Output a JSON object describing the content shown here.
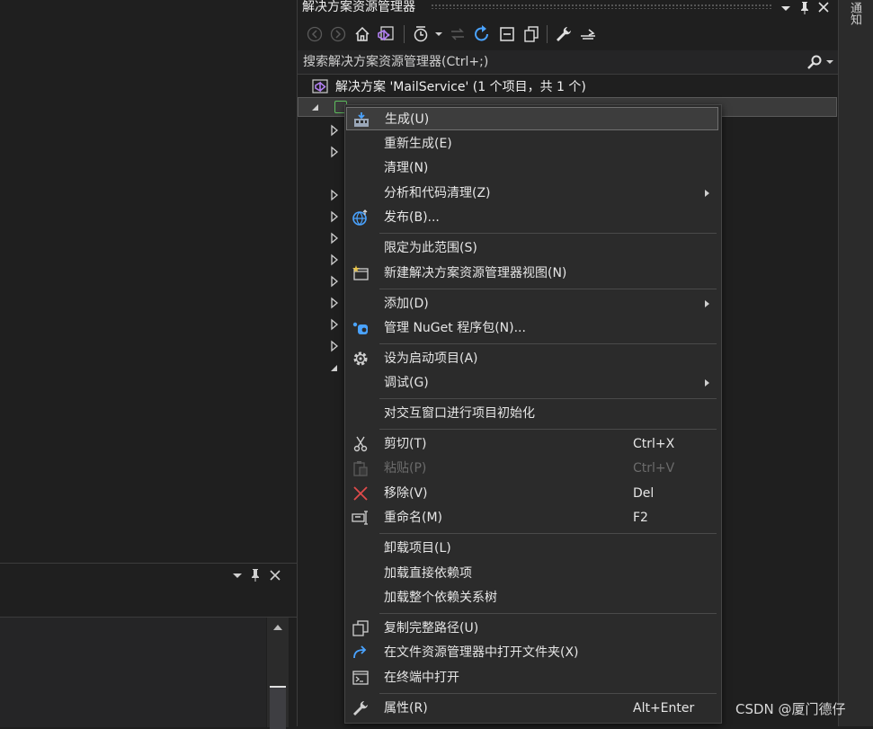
{
  "solution_explorer": {
    "title": "解决方案资源管理器",
    "search_placeholder": "搜索解决方案资源管理器(Ctrl+;)",
    "solution_node": "解决方案 'MailService' (1 个项目，共 1 个)"
  },
  "notification_tab": "通知",
  "context_menu": {
    "items": [
      {
        "label": "生成(U)",
        "icon": "build-icon",
        "highlighted": true
      },
      {
        "label": "重新生成(E)"
      },
      {
        "label": "清理(N)"
      },
      {
        "label": "分析和代码清理(Z)",
        "submenu": true
      },
      {
        "label": "发布(B)...",
        "icon": "publish-globe-icon"
      },
      {
        "label": "限定为此范围(S)"
      },
      {
        "label": "新建解决方案资源管理器视图(N)",
        "icon": "new-view-icon"
      },
      {
        "label": "添加(D)",
        "submenu": true
      },
      {
        "label": "管理 NuGet 程序包(N)...",
        "icon": "nuget-icon"
      },
      {
        "label": "设为启动项目(A)",
        "icon": "gear-icon"
      },
      {
        "label": "调试(G)",
        "submenu": true
      },
      {
        "label": "对交互窗口进行项目初始化"
      },
      {
        "label": "剪切(T)",
        "shortcut": "Ctrl+X",
        "icon": "scissors-icon"
      },
      {
        "label": "粘贴(P)",
        "shortcut": "Ctrl+V",
        "icon": "paste-icon",
        "disabled": true
      },
      {
        "label": "移除(V)",
        "shortcut": "Del",
        "icon": "remove-x-icon"
      },
      {
        "label": "重命名(M)",
        "shortcut": "F2",
        "icon": "rename-icon"
      },
      {
        "label": "卸载项目(L)"
      },
      {
        "label": "加载直接依赖项"
      },
      {
        "label": "加载整个依赖关系树"
      },
      {
        "label": "复制完整路径(U)",
        "icon": "copy-icon"
      },
      {
        "label": "在文件资源管理器中打开文件夹(X)",
        "icon": "open-folder-arrow-icon"
      },
      {
        "label": "在终端中打开",
        "icon": "terminal-icon"
      },
      {
        "label": "属性(R)",
        "shortcut": "Alt+Enter",
        "icon": "wrench-icon"
      }
    ]
  },
  "watermark": "CSDN @厦门德仔",
  "colors": {
    "background": "#1f1f1f",
    "menu_background": "#2b2b2b",
    "highlight": "#3d3d3d",
    "accent_blue": "#4aa3ff",
    "remove_red": "#e04b4b",
    "vs_purple": "#9b6bd6"
  }
}
